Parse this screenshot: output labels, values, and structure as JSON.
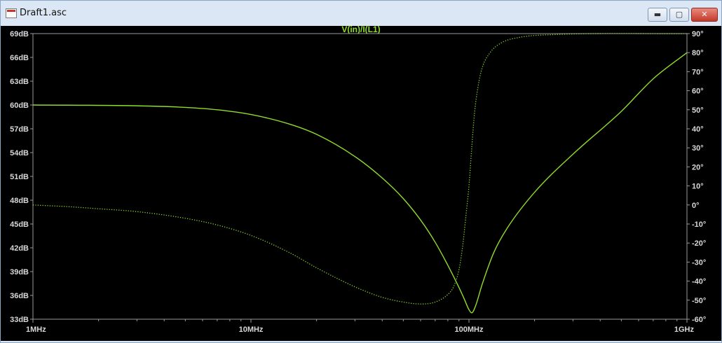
{
  "window": {
    "title": "Draft1.asc",
    "min_label": "▬",
    "max_label": "▢",
    "close_label": "✕"
  },
  "colors": {
    "background": "#000000",
    "trace": "#8fdc2b",
    "axis_text": "#d8d8d8"
  },
  "chart_data": {
    "type": "line",
    "title": "V(in)/I(L1)",
    "x_scale": "log",
    "xlim": [
      1000000,
      1000000000
    ],
    "x_ticks": [
      {
        "value": 1000000,
        "label": "1MHz"
      },
      {
        "value": 10000000,
        "label": "10MHz"
      },
      {
        "value": 100000000,
        "label": "100MHz"
      },
      {
        "value": 1000000000,
        "label": "1GHz"
      }
    ],
    "y_left": {
      "lim": [
        33,
        69
      ],
      "ticks": [
        "69dB",
        "66dB",
        "63dB",
        "60dB",
        "57dB",
        "54dB",
        "51dB",
        "48dB",
        "45dB",
        "42dB",
        "39dB",
        "36dB",
        "33dB"
      ]
    },
    "y_right": {
      "lim": [
        -60,
        90
      ],
      "ticks": [
        "90°",
        "80°",
        "70°",
        "60°",
        "50°",
        "40°",
        "30°",
        "20°",
        "10°",
        "0°",
        "-10°",
        "-20°",
        "-30°",
        "-40°",
        "-50°",
        "-60°"
      ]
    },
    "series": [
      {
        "quantity": "magnitude_dB",
        "style": "solid",
        "points": [
          [
            1000000,
            60.0
          ],
          [
            3000000,
            59.9
          ],
          [
            5000000,
            59.7
          ],
          [
            7000000,
            59.4
          ],
          [
            10000000,
            58.8
          ],
          [
            15000000,
            57.6
          ],
          [
            20000000,
            56.3
          ],
          [
            30000000,
            53.5
          ],
          [
            40000000,
            50.8
          ],
          [
            50000000,
            48.2
          ],
          [
            60000000,
            45.5
          ],
          [
            70000000,
            42.7
          ],
          [
            80000000,
            39.8
          ],
          [
            90000000,
            37.0
          ],
          [
            95000000,
            35.6
          ],
          [
            100000000,
            34.2
          ],
          [
            103000000,
            33.8
          ],
          [
            107000000,
            34.6
          ],
          [
            115000000,
            37.4
          ],
          [
            130000000,
            41.4
          ],
          [
            150000000,
            44.5
          ],
          [
            200000000,
            49.0
          ],
          [
            300000000,
            53.8
          ],
          [
            500000000,
            59.2
          ],
          [
            700000000,
            63.3
          ],
          [
            1000000000,
            66.6
          ]
        ]
      },
      {
        "quantity": "phase_deg",
        "style": "dotted",
        "points": [
          [
            1000000,
            0
          ],
          [
            1500000,
            -1
          ],
          [
            2000000,
            -2
          ],
          [
            3000000,
            -3.5
          ],
          [
            5000000,
            -7
          ],
          [
            7000000,
            -10.5
          ],
          [
            10000000,
            -16
          ],
          [
            15000000,
            -25
          ],
          [
            20000000,
            -33
          ],
          [
            30000000,
            -43
          ],
          [
            40000000,
            -48.5
          ],
          [
            50000000,
            -51
          ],
          [
            60000000,
            -52
          ],
          [
            70000000,
            -51
          ],
          [
            80000000,
            -47
          ],
          [
            85000000,
            -43
          ],
          [
            90000000,
            -34
          ],
          [
            93000000,
            -24
          ],
          [
            95000000,
            -15
          ],
          [
            97000000,
            -5
          ],
          [
            100000000,
            10
          ],
          [
            103000000,
            30
          ],
          [
            106000000,
            48
          ],
          [
            110000000,
            62
          ],
          [
            115000000,
            72
          ],
          [
            125000000,
            80
          ],
          [
            140000000,
            85
          ],
          [
            170000000,
            88
          ],
          [
            250000000,
            89.5
          ],
          [
            1000000000,
            90
          ]
        ]
      }
    ]
  }
}
